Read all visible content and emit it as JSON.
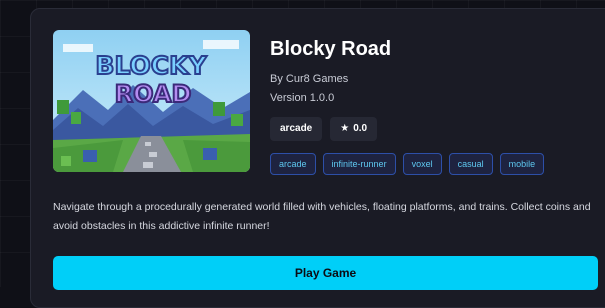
{
  "game": {
    "title": "Blocky Road",
    "author": "By Cur8 Games",
    "version": "Version 1.0.0",
    "category": "arcade",
    "rating": "0.0",
    "rating_icon": "star-icon",
    "tags": [
      "arcade",
      "infinite-runner",
      "voxel",
      "casual",
      "mobile"
    ],
    "description": "Navigate through a procedurally generated world filled with vehicles, floating platforms, and trains. Collect coins and avoid obstacles in this addictive infinite runner!",
    "play_label": "Play Game",
    "thumbnail_logo_text": [
      "BLOCKY",
      "ROAD"
    ]
  },
  "colors": {
    "accent": "#00cff8",
    "tag_border": "#2d4fa8",
    "tag_text": "#5ec8f0",
    "card_bg": "#1a1b25"
  }
}
